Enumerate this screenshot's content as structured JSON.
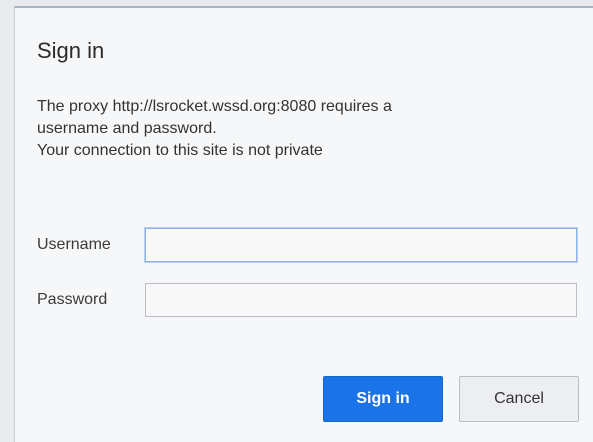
{
  "dialog": {
    "title": "Sign in",
    "message_line1": "The proxy http://lsrocket.wssd.org:8080 requires a",
    "message_line2": "username and password.",
    "message_line3": "Your connection to this site is not private",
    "username_label": "Username",
    "username_value": "",
    "password_label": "Password",
    "password_value": "",
    "sign_in_label": "Sign in",
    "cancel_label": "Cancel"
  },
  "colors": {
    "primary_button": "#1a73e8",
    "focus_border": "#8fb3e6"
  }
}
